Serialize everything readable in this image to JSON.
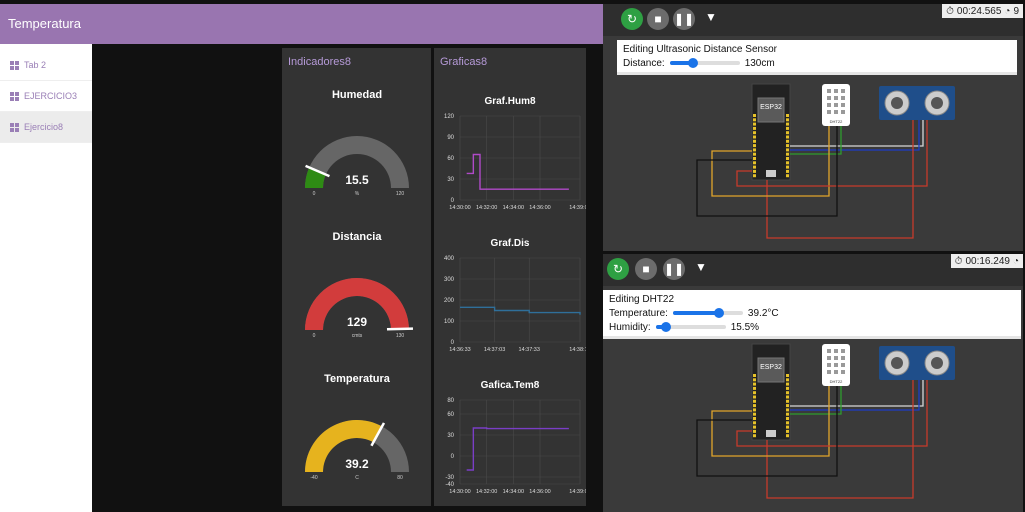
{
  "header": {
    "title": "Temperatura"
  },
  "nav": {
    "items": [
      {
        "label": "Tab 2",
        "active": false
      },
      {
        "label": "EJERCICIO3",
        "active": false
      },
      {
        "label": "Ejercicio8",
        "active": true
      }
    ]
  },
  "groups": {
    "indicadores": {
      "title": "Indicadores8"
    },
    "graficas": {
      "title": "Graficas8"
    }
  },
  "gauges": [
    {
      "title": "Humedad",
      "value": 15.5,
      "value_text": "15.5",
      "min": 0,
      "max": 120,
      "min_label": "0",
      "max_label": "120",
      "unit": "%",
      "color": "#2e8b14"
    },
    {
      "title": "Distancia",
      "value": 129,
      "value_text": "129",
      "min": 0,
      "max": 130,
      "min_label": "0",
      "max_label": "130",
      "unit": "cmts",
      "color": "#d23c3c"
    },
    {
      "title": "Temperatura",
      "value": 39.2,
      "value_text": "39.2",
      "min": -40,
      "max": 80,
      "min_label": "-40",
      "max_label": "80",
      "unit": "C",
      "color": "#e6b31e"
    }
  ],
  "charts": [
    {
      "title": "Graf.Hum8",
      "y_ticks": [
        "120",
        "90",
        "60",
        "30",
        "0"
      ],
      "x_ticks": [
        "14:30:00",
        "14:32:00",
        "14:34:00",
        "14:36:00",
        "14:39:00"
      ],
      "color": "#b04ac8"
    },
    {
      "title": "Graf.Dis",
      "y_ticks": [
        "400",
        "300",
        "200",
        "100",
        "0"
      ],
      "x_ticks": [
        "14:36:33",
        "14:37:03",
        "14:37:33",
        "14:38:17"
      ],
      "color": "#2f6f9a"
    },
    {
      "title": "Gafica.Tem8",
      "y_ticks": [
        "80",
        "60",
        "30",
        "0",
        "-30",
        "-40"
      ],
      "x_ticks": [
        "14:30:00",
        "14:32:00",
        "14:34:00",
        "14:36:00",
        "14:39:00"
      ],
      "color": "#7a3ec6"
    }
  ],
  "chart_data": [
    {
      "type": "line",
      "title": "Graf.Hum8",
      "x": [
        "14:30:30",
        "14:31:00",
        "14:31:20",
        "14:31:30",
        "14:36:00",
        "14:38:10"
      ],
      "series": [
        {
          "values": [
            38,
            65,
            65,
            15.5,
            15.5,
            15.5
          ]
        }
      ],
      "ylim": [
        0,
        120
      ]
    },
    {
      "type": "line",
      "title": "Graf.Dis",
      "x": [
        "14:36:33",
        "14:37:03",
        "14:37:33",
        "14:38:17"
      ],
      "series": [
        {
          "values": [
            165,
            150,
            140,
            130
          ]
        }
      ],
      "ylim": [
        0,
        400
      ]
    },
    {
      "type": "line",
      "title": "Gafica.Tem8",
      "x": [
        "14:30:30",
        "14:31:00",
        "14:32:00",
        "14:36:00",
        "14:38:10"
      ],
      "series": [
        {
          "values": [
            -20,
            40,
            39.2,
            39.2,
            39.2
          ]
        }
      ],
      "ylim": [
        -40,
        80
      ]
    }
  ],
  "wokwi": [
    {
      "timer": "00:24.565",
      "timer_extra": "9",
      "edit_title": "Editing Ultrasonic Distance Sensor",
      "fields": [
        {
          "label": "Distance:",
          "value": "130cm",
          "level": 0.33
        }
      ]
    },
    {
      "timer": "00:16.249",
      "timer_extra": "",
      "edit_title": "Editing DHT22",
      "fields": [
        {
          "label": "Temperature:",
          "value": "39.2°C",
          "level": 0.66
        },
        {
          "label": "Humidity:",
          "value": "15.5%",
          "level": 0.15
        }
      ]
    }
  ],
  "parts": {
    "mcu": "ESP32",
    "dht": "DHT22"
  },
  "colors": {
    "header": "#9975b0",
    "accent": "#b69ad8"
  }
}
